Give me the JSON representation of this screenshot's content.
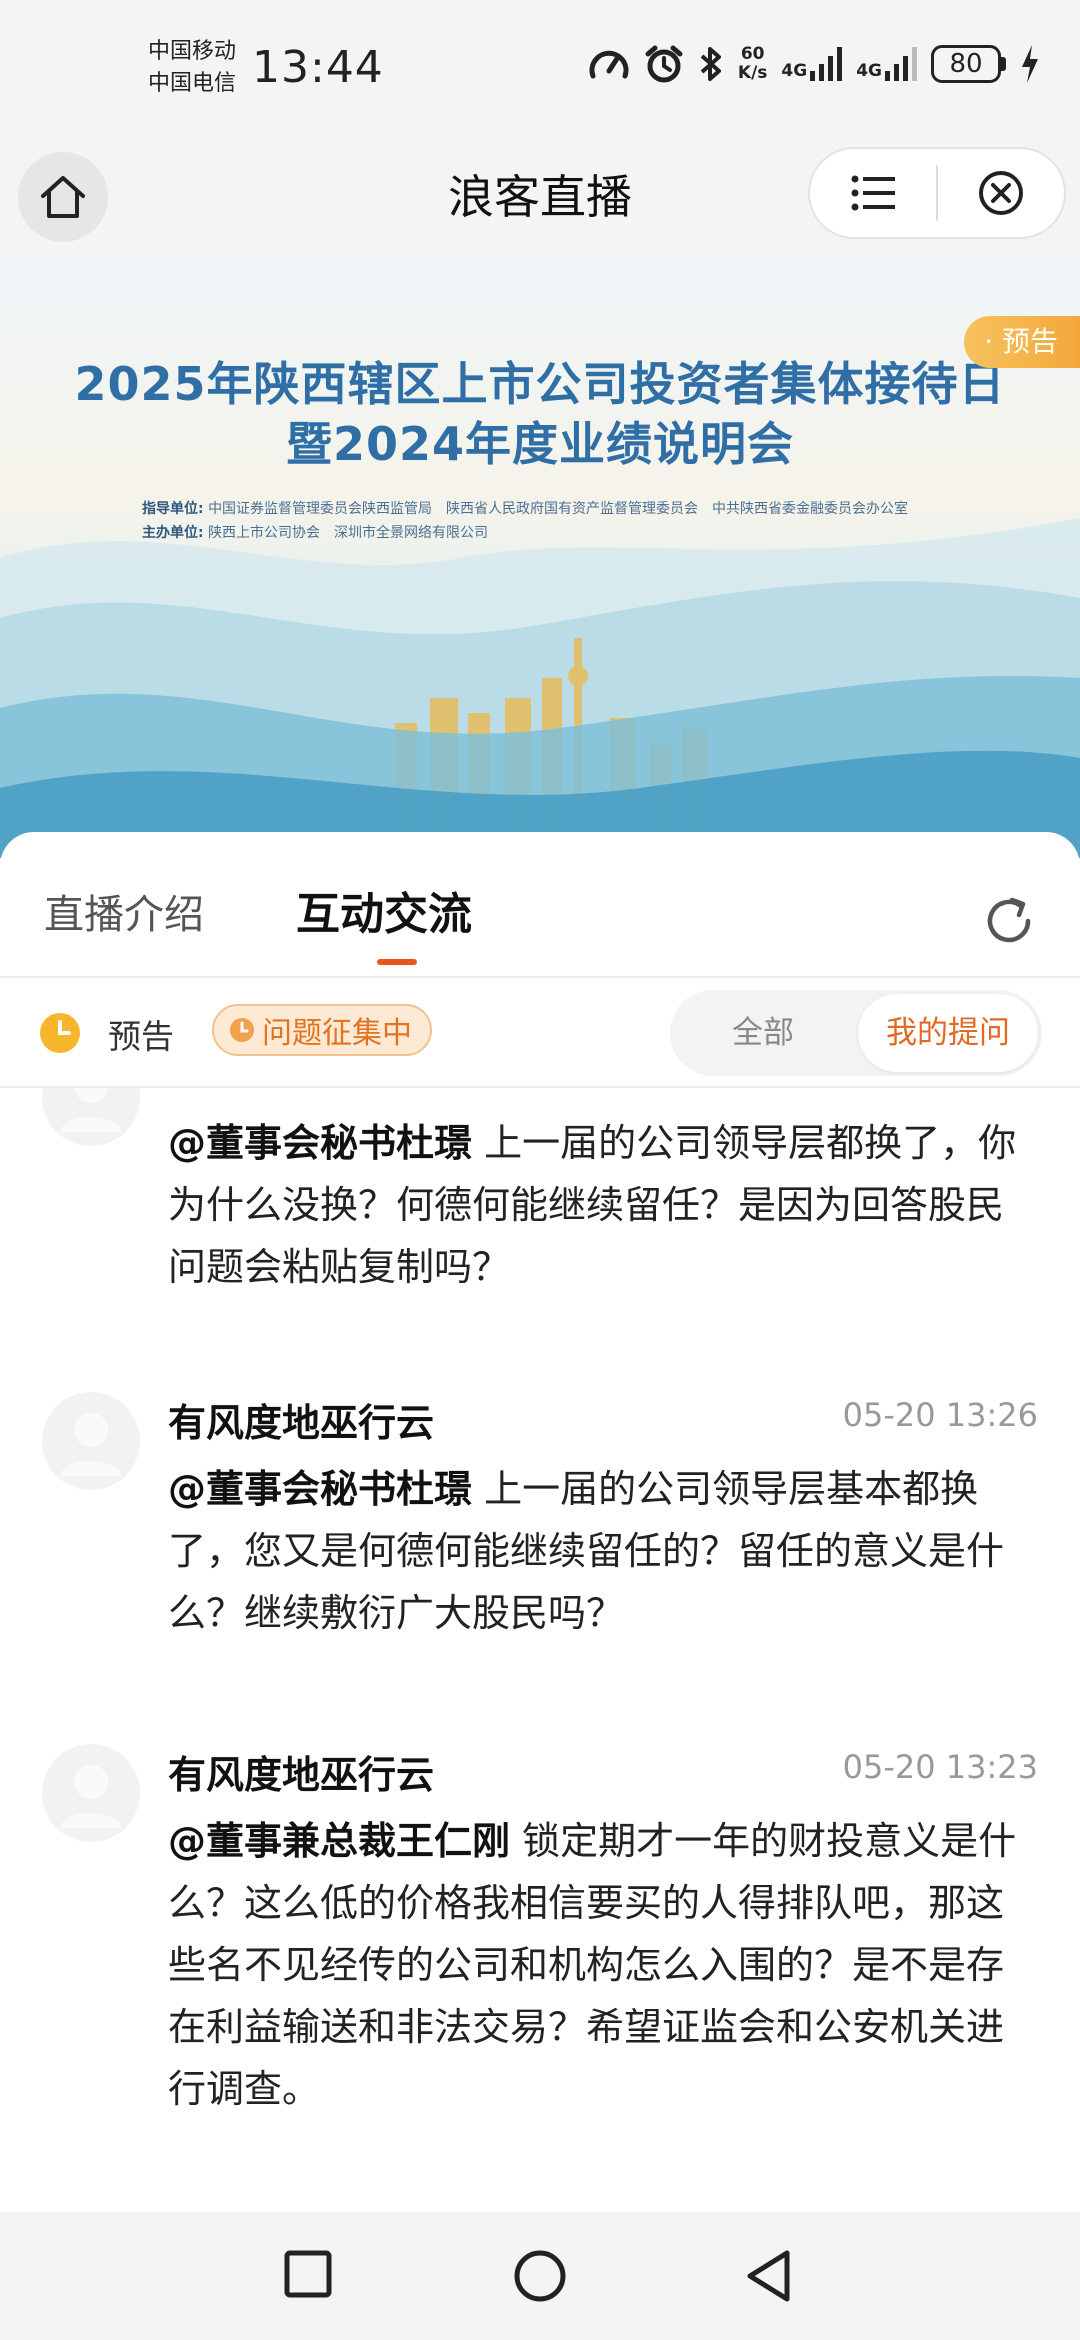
{
  "status_bar": {
    "carrier1": "中国移动",
    "carrier2": "中国电信",
    "time": "13:44",
    "net_speed_top": "60",
    "net_speed_bottom": "K/s",
    "sig1": "4G",
    "sig2": "4G",
    "battery": "80"
  },
  "header": {
    "title": "浪客直播",
    "home_icon": "home-icon",
    "menu_icon": "list-icon",
    "close_icon": "close-circle-icon"
  },
  "banner": {
    "title_line1": "2025年陕西辖区上市公司投资者集体接待日",
    "title_line2": "暨2024年度业绩说明会",
    "org_label1": "指导单位:",
    "org_text1": "中国证券监督管理委员会陕西监管局　陕西省人民政府国有资产监督管理委员会　中共陕西省委金融委员会办公室",
    "org_label2": "主办单位:",
    "org_text2": "陕西上市公司协会　深圳市全景网络有限公司",
    "tag": "· 预告"
  },
  "tabs": {
    "intro": "直播介绍",
    "chat": "互动交流"
  },
  "filter": {
    "status": "预告",
    "badge": "问题征集中",
    "all": "全部",
    "mine": "我的提问"
  },
  "comments": [
    {
      "user": "",
      "time": "",
      "mention": "@董事会秘书杜璟",
      "text": " 上一届的公司领导层都换了，你为什么没换？何德何能继续留任？是因为回答股民问题会粘贴复制吗？"
    },
    {
      "user": "有风度地巫行云",
      "time": "05-20 13:26",
      "mention": "@董事会秘书杜璟",
      "text": " 上一届的公司领导层基本都换了，您又是何德何能继续留任的？留任的意义是什么？继续敷衍广大股民吗？"
    },
    {
      "user": "有风度地巫行云",
      "time": "05-20 13:23",
      "mention": "@董事兼总裁王仁刚",
      "text": " 锁定期才一年的财投意义是什么？这么低的价格我相信要买的人得排队吧，那这些名不见经传的公司和机构怎么入围的？是不是存在利益输送和非法交易？希望证监会和公安机关进行调查。"
    }
  ],
  "colors": {
    "accent": "#e8541e",
    "badge_text": "#e27321",
    "banner_title": "#2f6fa6"
  }
}
